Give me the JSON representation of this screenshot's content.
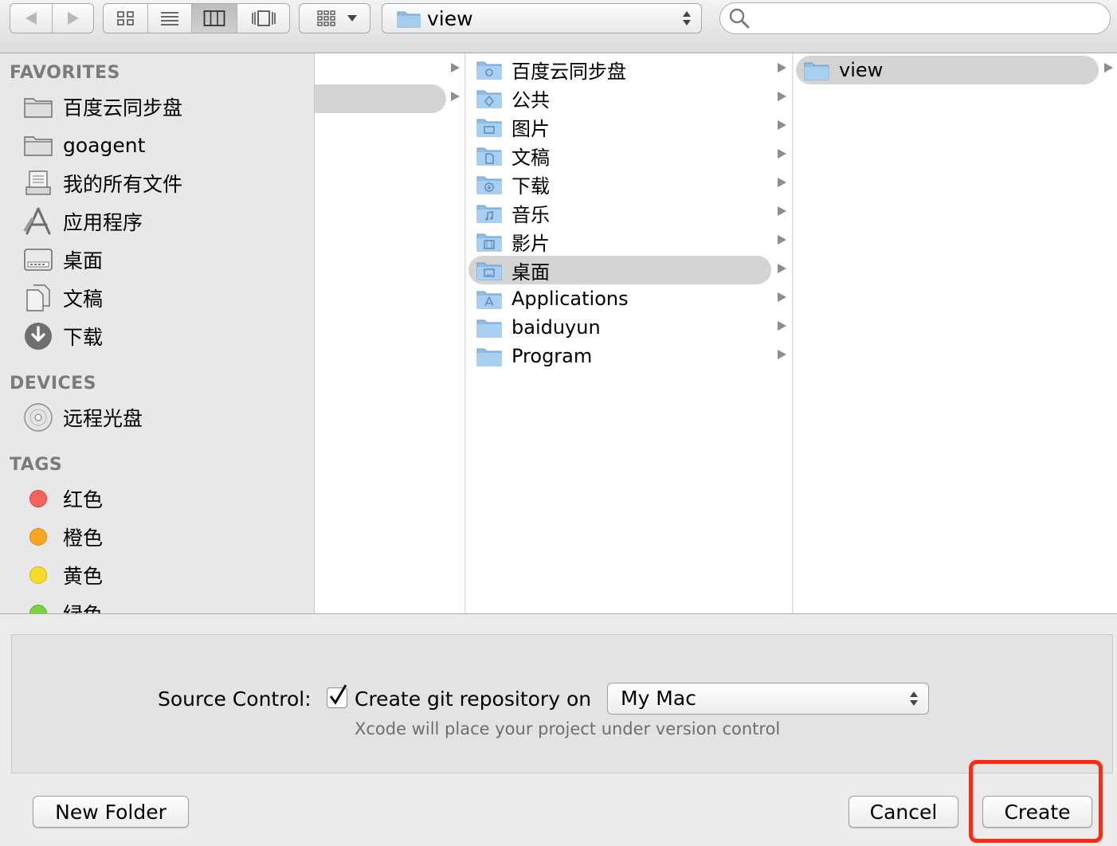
{
  "toolbar": {
    "path_popup_title": "view"
  },
  "sidebar": {
    "favorites_header": "FAVORITES",
    "favorites": [
      {
        "label": "百度云同步盘",
        "icon": "folder-icon"
      },
      {
        "label": "goagent",
        "icon": "folder-icon"
      },
      {
        "label": "我的所有文件",
        "icon": "all-my-files-icon"
      },
      {
        "label": "应用程序",
        "icon": "applications-icon"
      },
      {
        "label": "桌面",
        "icon": "desktop-icon"
      },
      {
        "label": "文稿",
        "icon": "documents-icon"
      },
      {
        "label": "下载",
        "icon": "downloads-icon"
      }
    ],
    "devices_header": "DEVICES",
    "devices": [
      {
        "label": "远程光盘",
        "icon": "remote-disc-icon"
      }
    ],
    "tags_header": "TAGS",
    "tags": [
      {
        "label": "红色",
        "color": "#f3625d"
      },
      {
        "label": "橙色",
        "color": "#f6a623"
      },
      {
        "label": "黄色",
        "color": "#f5dc2b"
      },
      {
        "label": "绿色",
        "color": "#7dd237"
      }
    ]
  },
  "columns": {
    "column2": [
      {
        "label": "百度云同步盘",
        "icon": "baidu-folder-icon"
      },
      {
        "label": "公共",
        "icon": "public-folder-icon"
      },
      {
        "label": "图片",
        "icon": "pictures-folder-icon"
      },
      {
        "label": "文稿",
        "icon": "documents-folder-icon"
      },
      {
        "label": "下载",
        "icon": "downloads-folder-icon"
      },
      {
        "label": "音乐",
        "icon": "music-folder-icon"
      },
      {
        "label": "影片",
        "icon": "movies-folder-icon"
      },
      {
        "label": "桌面",
        "icon": "desktop-folder-icon",
        "selected": true
      },
      {
        "label": "Applications",
        "icon": "applications-folder-icon"
      },
      {
        "label": "baiduyun",
        "icon": "folder-icon"
      },
      {
        "label": "Program",
        "icon": "folder-icon"
      }
    ],
    "column3": [
      {
        "label": "view",
        "icon": "folder-icon",
        "selected": true
      }
    ]
  },
  "options": {
    "source_control_label": "Source Control:",
    "git_checkbox_label": "Create git repository on",
    "git_checkbox_checked": true,
    "location_popup_value": "My Mac",
    "version_control_note": "Xcode will place your project under version control"
  },
  "buttons": {
    "new_folder": "New Folder",
    "cancel": "Cancel",
    "create": "Create"
  },
  "highlight_color": "#ff2a10"
}
